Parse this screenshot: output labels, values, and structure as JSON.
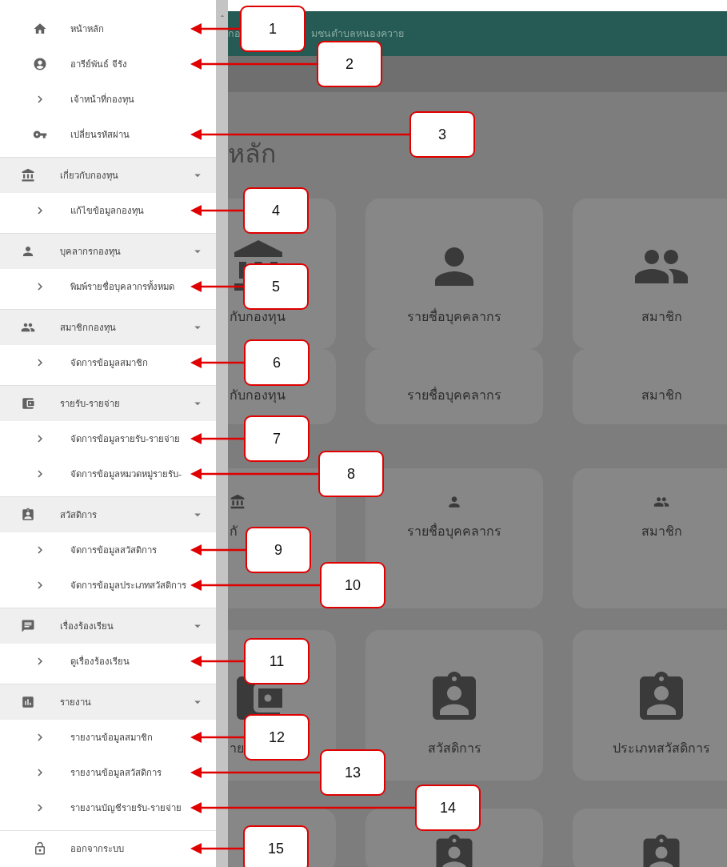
{
  "sidebar": {
    "items": [
      {
        "kind": "link",
        "label": "หน้าหลัก",
        "callout": "1"
      },
      {
        "kind": "link",
        "label": "อารีย์พันธ์ จีรัง",
        "callout": "2"
      },
      {
        "kind": "submenu",
        "label": "เจ้าหน้าที่กองทุน"
      },
      {
        "kind": "link",
        "label": "เปลี่ยนรหัสผ่าน",
        "callout": "3"
      },
      {
        "kind": "group",
        "label": "เกี่ยวกับกองทุน",
        "expanded": true,
        "children": [
          {
            "label": "แก้ไขข้อมูลกองทุน",
            "callout": "4"
          }
        ]
      },
      {
        "kind": "group",
        "label": "บุคลากรกองทุน",
        "expanded": true,
        "children": [
          {
            "label": "พิมพ์รายชื่อบุคลากรทั้งหมด",
            "callout": "5"
          }
        ]
      },
      {
        "kind": "group",
        "label": "สมาชิกกองทุน",
        "expanded": true,
        "children": [
          {
            "label": "จัดการข้อมูลสมาชิก",
            "callout": "6"
          }
        ]
      },
      {
        "kind": "group",
        "label": "รายรับ-รายจ่าย",
        "expanded": true,
        "children": [
          {
            "label": "จัดการข้อมูลรายรับ-รายจ่าย",
            "callout": "7"
          },
          {
            "label": "จัดการข้อมูลหมวดหมู่รายรับ-",
            "callout": "8"
          }
        ]
      },
      {
        "kind": "group",
        "label": "สวัสดิการ",
        "expanded": true,
        "children": [
          {
            "label": "จัดการข้อมูลสวัสดิการ",
            "callout": "9"
          },
          {
            "label": "จัดการข้อมูลประเภทสวัสดิการ",
            "callout": "10"
          }
        ]
      },
      {
        "kind": "group",
        "label": "เรื่องร้องเรียน",
        "expanded": true,
        "children": [
          {
            "label": "ดูเรื่องร้องเรียน",
            "callout": "11"
          }
        ]
      },
      {
        "kind": "group",
        "label": "รายงาน",
        "expanded": true,
        "children": [
          {
            "label": "รายงานข้อมูลสมาชิก",
            "callout": "12"
          },
          {
            "label": "รายงานข้อมูลสวัสดิการ",
            "callout": "13"
          },
          {
            "label": "รายงานบัญชีรายรับ-รายจ่าย",
            "callout": "14"
          }
        ]
      },
      {
        "kind": "logout",
        "label": "ออกจากระบบ",
        "callout": "15"
      }
    ]
  },
  "main": {
    "header_texts": [
      "กอ",
      "มชนตำบลหนองควาย"
    ],
    "title": "หลัก",
    "card_rows": [
      {
        "kind": "full",
        "cards": [
          {
            "label": "กับกองทุน"
          },
          {
            "label": "รายชื่อบุคคลากร"
          },
          {
            "label": "สมาชิก"
          }
        ]
      },
      {
        "kind": "label",
        "cards": [
          {
            "label": "กับกองทุน"
          },
          {
            "label": "รายชื่อบุคคลากร"
          },
          {
            "label": "สมาชิก"
          }
        ]
      },
      {
        "kind": "clipped",
        "cards": [
          {
            "label": "กั"
          },
          {
            "label": "รายชื่อบุคคลากร"
          },
          {
            "label": "สมาชิก"
          }
        ]
      },
      {
        "kind": "full",
        "cards": [
          {
            "label": "าย"
          },
          {
            "label": "สวัสดิการ"
          },
          {
            "label": "ประเภทสวัสดิการ"
          }
        ]
      },
      {
        "kind": "top"
      }
    ]
  }
}
